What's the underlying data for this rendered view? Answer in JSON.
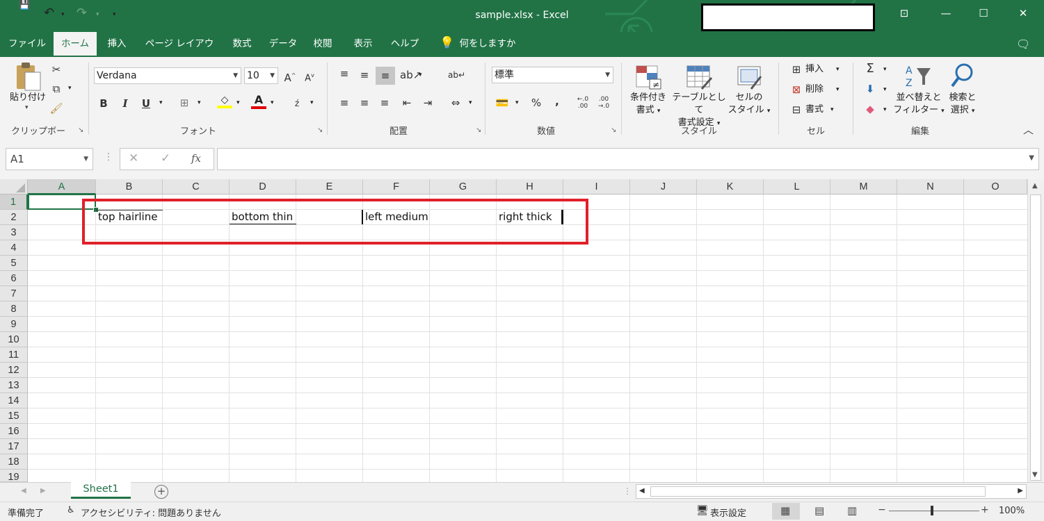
{
  "window": {
    "title": "sample.xlsx  -  Excel",
    "minimize": "—",
    "maximize": "☐",
    "close": "✕"
  },
  "quick_access": {
    "save": "💾",
    "undo": "↶",
    "redo": "↷",
    "more": "▾"
  },
  "menu": {
    "items": [
      "ファイル",
      "ホーム",
      "挿入",
      "ページ レイアウト",
      "数式",
      "データ",
      "校閲",
      "表示",
      "ヘルプ"
    ],
    "tell_me": "何をしますか"
  },
  "ribbon": {
    "clipboard": {
      "label": "クリップボード",
      "paste_label": "貼り付け"
    },
    "font": {
      "label": "フォント",
      "name": "Verdana",
      "size": "10",
      "bold": "B",
      "italic": "I",
      "underline": "U"
    },
    "alignment": {
      "label": "配置"
    },
    "number": {
      "label": "数値",
      "format": "標準",
      "percent": "%",
      "comma": ","
    },
    "styles": {
      "label": "スタイル",
      "conditional_line1": "条件付き",
      "conditional_line2": "書式",
      "table_line1": "テーブルとして",
      "table_line2": "書式設定",
      "cell_style_line1": "セルの",
      "cell_style_line2": "スタイル"
    },
    "cells": {
      "label": "セル",
      "insert": "挿入",
      "delete": "削除",
      "format": "書式"
    },
    "editing": {
      "label": "編集",
      "sort_line1": "並べ替えと",
      "sort_line2": "フィルター",
      "find_line1": "検索と",
      "find_line2": "選択"
    }
  },
  "formula_bar": {
    "name_box": "A1",
    "fx": "fx",
    "value": ""
  },
  "grid": {
    "columns": [
      "A",
      "B",
      "C",
      "D",
      "E",
      "F",
      "G",
      "H",
      "I",
      "J",
      "K",
      "L",
      "M",
      "N",
      "O"
    ],
    "rows": [
      "1",
      "2",
      "3",
      "4",
      "5",
      "6",
      "7",
      "8",
      "9",
      "10",
      "11",
      "12",
      "13",
      "14",
      "15",
      "16",
      "17",
      "18",
      "19"
    ],
    "cells": {
      "B2": "top hairline",
      "D2": "bottom thin",
      "F2": "left medium",
      "H2": "right thick"
    },
    "highlight_color": "#e0202a"
  },
  "sheets": {
    "tabs": [
      "Sheet1"
    ],
    "add": "+"
  },
  "status": {
    "ready": "準備完了",
    "accessibility": "アクセシビリティ: 問題ありません",
    "display_settings": "表示設定",
    "zoom": "100%"
  },
  "colors": {
    "brand": "#217346"
  }
}
